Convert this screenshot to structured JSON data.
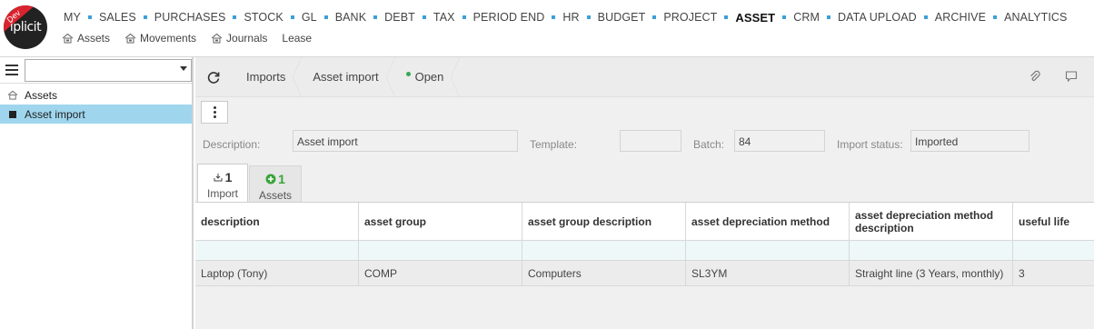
{
  "branding": {
    "logo_text": "iplicit",
    "env_badge": "Dev"
  },
  "main_nav": [
    {
      "label": "MY"
    },
    {
      "label": "SALES"
    },
    {
      "label": "PURCHASES"
    },
    {
      "label": "STOCK"
    },
    {
      "label": "GL"
    },
    {
      "label": "BANK"
    },
    {
      "label": "DEBT"
    },
    {
      "label": "TAX"
    },
    {
      "label": "PERIOD END"
    },
    {
      "label": "HR"
    },
    {
      "label": "BUDGET"
    },
    {
      "label": "PROJECT"
    },
    {
      "label": "ASSET"
    },
    {
      "label": "CRM"
    },
    {
      "label": "DATA UPLOAD"
    },
    {
      "label": "ARCHIVE"
    },
    {
      "label": "ANALYTICS"
    }
  ],
  "main_nav_active": "ASSET",
  "sub_nav": [
    {
      "label": "Assets",
      "icon": "asset-icon"
    },
    {
      "label": "Movements",
      "icon": "asset-icon"
    },
    {
      "label": "Journals",
      "icon": "asset-icon"
    },
    {
      "label": "Lease",
      "icon": ""
    }
  ],
  "left_panel": {
    "select_value": "",
    "tree": [
      {
        "label": "Assets",
        "icon": "asset-icon",
        "selected": false
      },
      {
        "label": "Asset import",
        "icon": "square-icon",
        "selected": true
      }
    ]
  },
  "breadcrumb": {
    "items": [
      "Imports",
      "Asset import"
    ],
    "status": "Open"
  },
  "form": {
    "description_label": "Description:",
    "description_value": "Asset import",
    "template_label": "Template:",
    "template_value": "",
    "batch_label": "Batch:",
    "batch_value": "84",
    "import_status_label": "Import status:",
    "import_status_value": "Imported"
  },
  "tabs": [
    {
      "count": "1",
      "label": "Import",
      "icon": "import-icon"
    },
    {
      "count": "1",
      "label": "Assets",
      "icon": "plus-circle-icon"
    }
  ],
  "grid": {
    "headers": [
      "description",
      "asset group",
      "asset group description",
      "asset depreciation method",
      "asset depreciation method description",
      "useful life"
    ],
    "rows": [
      [
        "Laptop (Tony)",
        "COMP",
        "Computers",
        "SL3YM",
        "Straight line (3 Years, monthly)",
        "3"
      ]
    ]
  },
  "colors": {
    "accent": "#3aa0d8",
    "selected_row": "#9fd6ee",
    "status_green": "#35a853",
    "badge_red": "#d9232e"
  }
}
